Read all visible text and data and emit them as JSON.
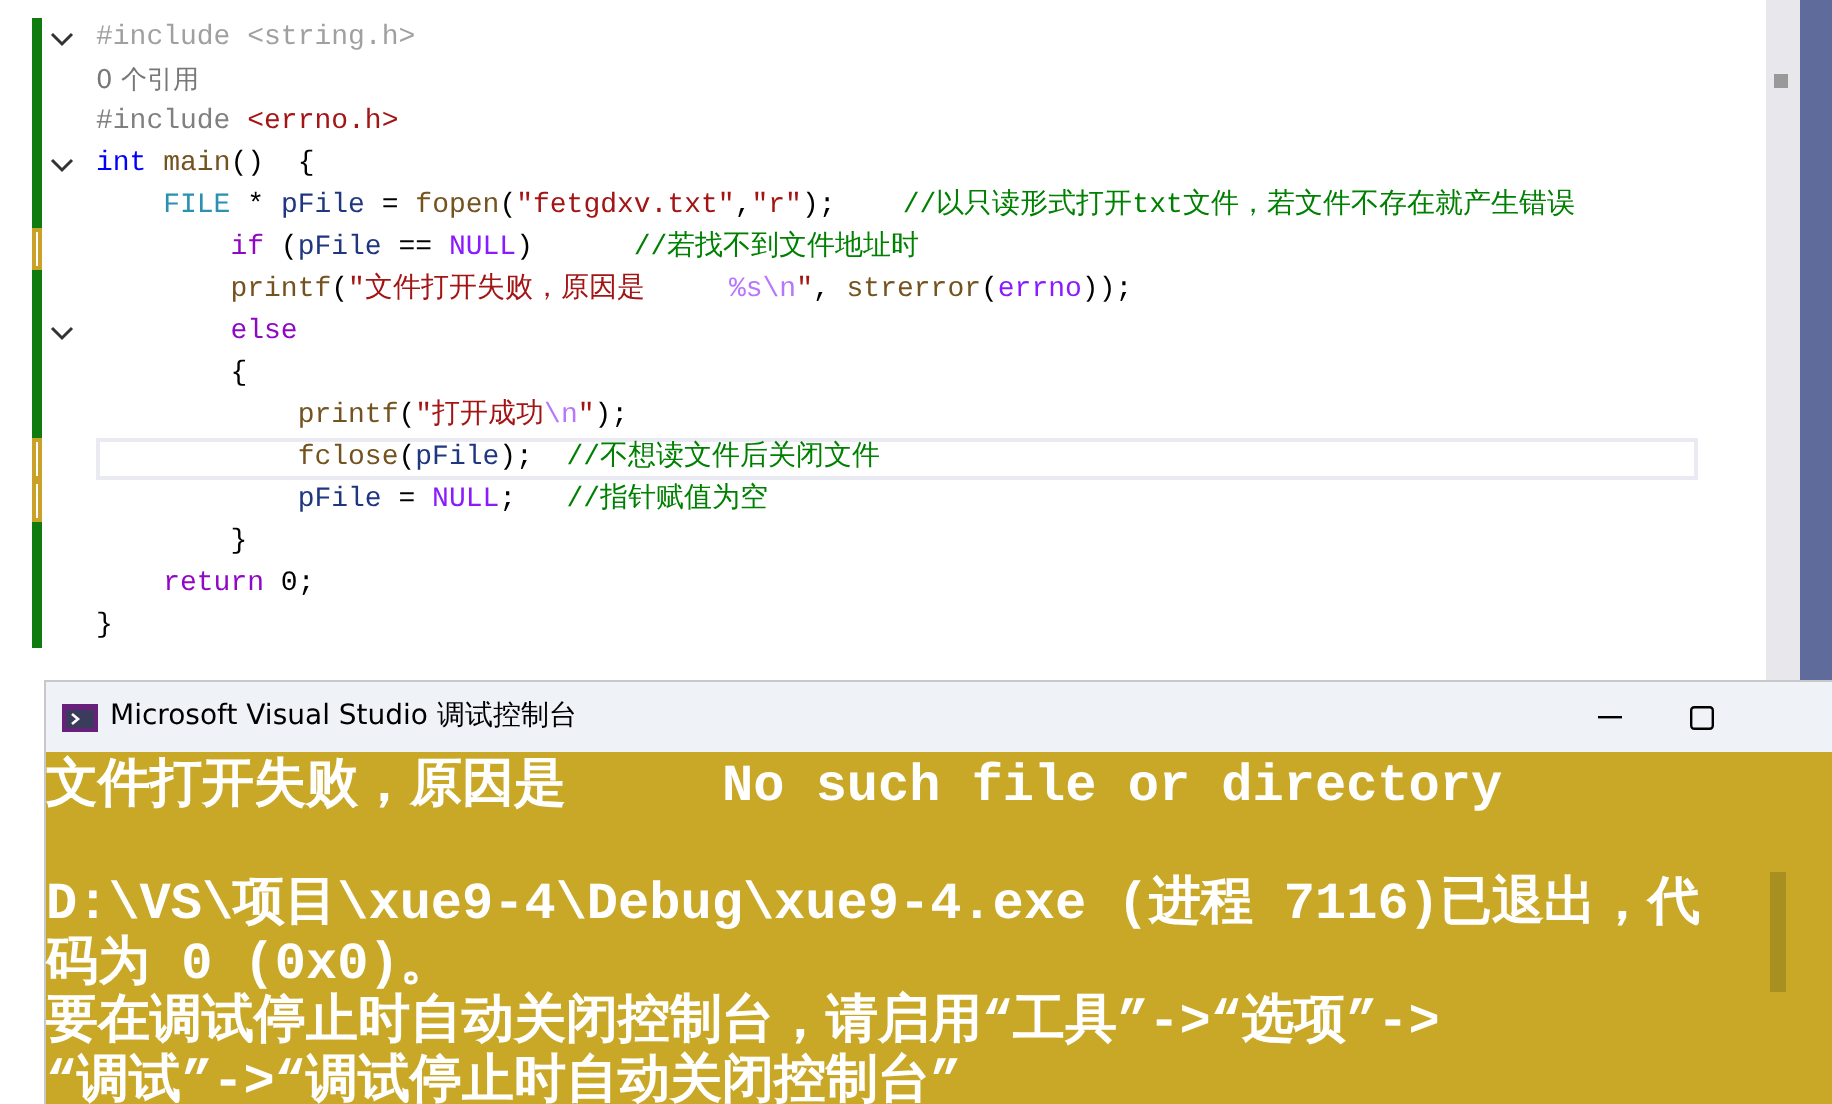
{
  "editor": {
    "lines": [
      {
        "fold": true,
        "modified": false,
        "current": false,
        "tokens": [
          {
            "text": "#include <string.h>",
            "kind": "dim"
          }
        ]
      },
      {
        "fold": false,
        "modified": false,
        "current": false,
        "tokens": [
          {
            "text": "0 个引用",
            "kind": "codelens"
          }
        ]
      },
      {
        "fold": false,
        "modified": false,
        "current": false,
        "tokens": [
          {
            "text": "#include ",
            "kind": "preprocessor"
          },
          {
            "text": "<errno.h>",
            "kind": "string"
          }
        ]
      },
      {
        "fold": true,
        "modified": false,
        "current": false,
        "tokens": [
          {
            "text": "int",
            "kind": "keyword"
          },
          {
            "text": " main",
            "kind": "function"
          },
          {
            "text": "()  {",
            "kind": "plain"
          }
        ]
      },
      {
        "fold": false,
        "modified": false,
        "current": false,
        "tokens": [
          {
            "text": "    FILE",
            "kind": "type"
          },
          {
            "text": " * ",
            "kind": "plain"
          },
          {
            "text": "pFile",
            "kind": "variable"
          },
          {
            "text": " = ",
            "kind": "plain"
          },
          {
            "text": "fopen",
            "kind": "function"
          },
          {
            "text": "(",
            "kind": "plain"
          },
          {
            "text": "\"fetgdxv.txt\"",
            "kind": "string"
          },
          {
            "text": ",",
            "kind": "plain"
          },
          {
            "text": "\"r\"",
            "kind": "string"
          },
          {
            "text": ");    ",
            "kind": "plain"
          },
          {
            "text": "//以只读形式打开txt文件，若文件不存在就产生错误",
            "kind": "comment"
          }
        ]
      },
      {
        "fold": false,
        "modified": true,
        "current": false,
        "tokens": [
          {
            "text": "        if",
            "kind": "control"
          },
          {
            "text": " (",
            "kind": "plain"
          },
          {
            "text": "pFile",
            "kind": "variable"
          },
          {
            "text": " == ",
            "kind": "plain"
          },
          {
            "text": "NULL",
            "kind": "macro"
          },
          {
            "text": ")      ",
            "kind": "plain"
          },
          {
            "text": "//若找不到文件地址时",
            "kind": "comment"
          }
        ]
      },
      {
        "fold": false,
        "modified": false,
        "current": false,
        "tokens": [
          {
            "text": "        printf",
            "kind": "function"
          },
          {
            "text": "(",
            "kind": "plain"
          },
          {
            "text": "\"文件打开失败，原因是     ",
            "kind": "string"
          },
          {
            "text": "%s\\n",
            "kind": "escape"
          },
          {
            "text": "\"",
            "kind": "string"
          },
          {
            "text": ", ",
            "kind": "plain"
          },
          {
            "text": "strerror",
            "kind": "function"
          },
          {
            "text": "(",
            "kind": "plain"
          },
          {
            "text": "errno",
            "kind": "macro"
          },
          {
            "text": "));",
            "kind": "plain"
          }
        ]
      },
      {
        "fold": true,
        "modified": false,
        "current": false,
        "tokens": [
          {
            "text": "        else",
            "kind": "control"
          }
        ]
      },
      {
        "fold": false,
        "modified": false,
        "current": false,
        "tokens": [
          {
            "text": "        {",
            "kind": "plain"
          }
        ]
      },
      {
        "fold": false,
        "modified": false,
        "current": false,
        "tokens": [
          {
            "text": "            printf",
            "kind": "function"
          },
          {
            "text": "(",
            "kind": "plain"
          },
          {
            "text": "\"打开成功",
            "kind": "string"
          },
          {
            "text": "\\n",
            "kind": "escape"
          },
          {
            "text": "\"",
            "kind": "string"
          },
          {
            "text": ");",
            "kind": "plain"
          }
        ]
      },
      {
        "fold": false,
        "modified": true,
        "current": true,
        "tokens": [
          {
            "text": "            fclose",
            "kind": "function"
          },
          {
            "text": "(",
            "kind": "plain"
          },
          {
            "text": "pFile",
            "kind": "variable"
          },
          {
            "text": ");  ",
            "kind": "plain"
          },
          {
            "text": "//不想读文件后关闭文件",
            "kind": "comment"
          }
        ]
      },
      {
        "fold": false,
        "modified": true,
        "current": false,
        "tokens": [
          {
            "text": "            pFile",
            "kind": "variable"
          },
          {
            "text": " = ",
            "kind": "plain"
          },
          {
            "text": "NULL",
            "kind": "macro"
          },
          {
            "text": ";   ",
            "kind": "plain"
          },
          {
            "text": "//指针赋值为空",
            "kind": "comment"
          }
        ]
      },
      {
        "fold": false,
        "modified": false,
        "current": false,
        "tokens": [
          {
            "text": "        }",
            "kind": "plain"
          }
        ]
      },
      {
        "fold": false,
        "modified": false,
        "current": false,
        "tokens": [
          {
            "text": "    return",
            "kind": "control"
          },
          {
            "text": " 0;",
            "kind": "plain"
          }
        ]
      },
      {
        "fold": false,
        "modified": false,
        "current": false,
        "tokens": [
          {
            "text": "}",
            "kind": "plain"
          }
        ]
      }
    ]
  },
  "console": {
    "title": "Microsoft Visual Studio 调试控制台",
    "paragraphs": [
      {
        "lines": [
          "文件打开失败，原因是     No such file or directory"
        ]
      },
      {
        "lines": [
          "D:\\VS\\项目\\xue9-4\\Debug\\xue9-4.exe (进程 7116)已退出，代",
          "码为 0 (0x0)。",
          "要在调试停止时自动关闭控制台，请启用“工具”->“选项”->",
          "“调试”->“调试停止时自动关闭控制台”"
        ]
      }
    ]
  }
}
